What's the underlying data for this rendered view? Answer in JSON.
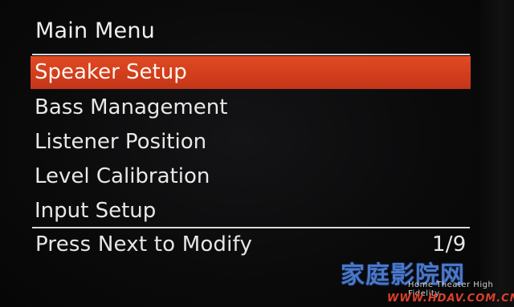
{
  "menu": {
    "title": "Main Menu",
    "items": [
      {
        "label": "Speaker Setup",
        "selected": true
      },
      {
        "label": "Bass Management",
        "selected": false
      },
      {
        "label": "Listener Position",
        "selected": false
      },
      {
        "label": "Level Calibration",
        "selected": false
      },
      {
        "label": "Input Setup",
        "selected": false
      }
    ],
    "selected_color": "#d6401e"
  },
  "status": {
    "hint": "Press Next to Modify",
    "page": "1/9"
  },
  "watermark": {
    "name": "家庭影院网",
    "tagline": "Home Theater High Fidelity",
    "url": "WWW.HDAV.COM.CN"
  }
}
